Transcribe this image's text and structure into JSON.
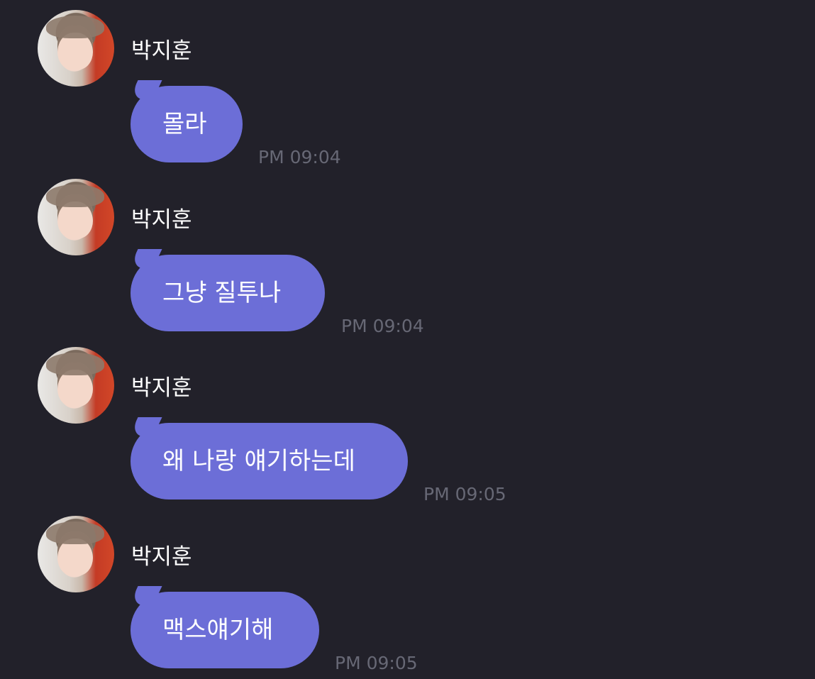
{
  "messages": [
    {
      "sender": "박지훈",
      "text": "몰라",
      "time": "PM 09:04"
    },
    {
      "sender": "박지훈",
      "text": "그냥 질투나",
      "time": "PM 09:04"
    },
    {
      "sender": "박지훈",
      "text": "왜 나랑 얘기하는데",
      "time": "PM 09:05"
    },
    {
      "sender": "박지훈",
      "text": "맥스얘기해",
      "time": "PM 09:05"
    }
  ],
  "colors": {
    "background": "#22212a",
    "bubble": "#6c6ed7",
    "timestamp": "#676875",
    "text": "#ffffff"
  }
}
